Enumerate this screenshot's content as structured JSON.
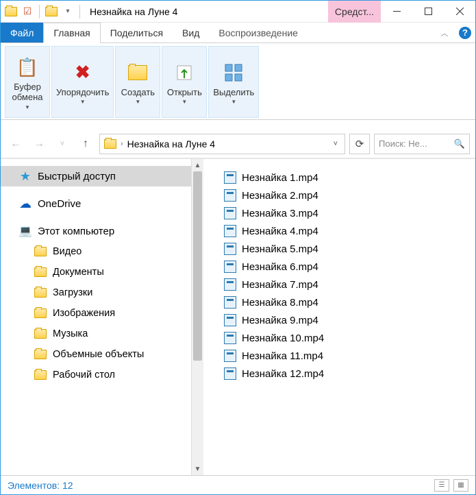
{
  "titlebar": {
    "title": "Незнайка на Луне 4",
    "contextual_tab": "Средст..."
  },
  "tabs": {
    "file": "Файл",
    "home": "Главная",
    "share": "Поделиться",
    "view": "Вид",
    "playback": "Воспроизведение"
  },
  "ribbon": {
    "clipboard": "Буфер\nобмена",
    "organize": "Упорядочить",
    "create": "Создать",
    "open": "Открыть",
    "select": "Выделить"
  },
  "address": {
    "crumb": "Незнайка на Луне 4"
  },
  "search": {
    "placeholder": "Поиск: Не..."
  },
  "tree": {
    "quick_access": "Быстрый доступ",
    "onedrive": "OneDrive",
    "this_pc": "Этот компьютер",
    "children": [
      "Видео",
      "Документы",
      "Загрузки",
      "Изображения",
      "Музыка",
      "Объемные объекты",
      "Рабочий стол"
    ]
  },
  "files": [
    "Незнайка 1.mp4",
    "Незнайка 2.mp4",
    "Незнайка 3.mp4",
    "Незнайка 4.mp4",
    "Незнайка 5.mp4",
    "Незнайка 6.mp4",
    "Незнайка 7.mp4",
    "Незнайка 8.mp4",
    "Незнайка 9.mp4",
    "Незнайка 10.mp4",
    "Незнайка 11.mp4",
    "Незнайка 12.mp4"
  ],
  "status": {
    "label": "Элементов:",
    "count": "12"
  }
}
